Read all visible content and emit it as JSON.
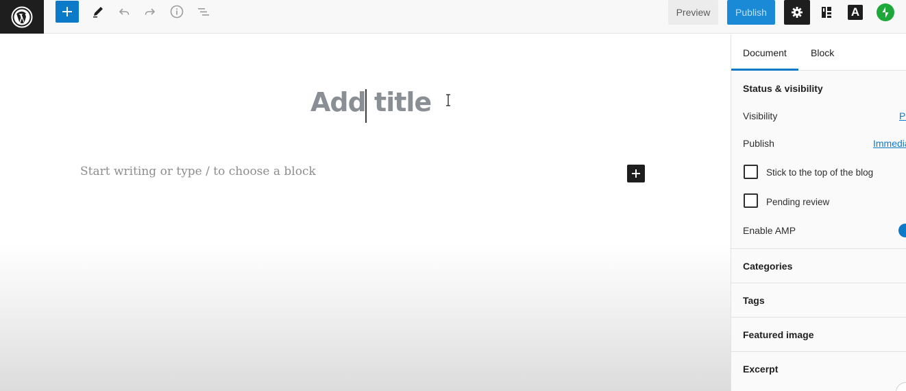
{
  "toolbar": {
    "preview_label": "Preview",
    "publish_label": "Publish",
    "icons": [
      "wordpress-logo",
      "plus-icon",
      "pencil-icon",
      "undo-icon",
      "redo-icon",
      "info-icon",
      "list-view-icon",
      "gear-icon",
      "block-layout-icon",
      "amp-icon",
      "jetpack-icon"
    ],
    "amp_letter": "A"
  },
  "editor": {
    "title_placeholder": "Add title",
    "body_placeholder": "Start writing or type / to choose a block"
  },
  "sidebar": {
    "tabs": [
      {
        "label": "Document",
        "active": true
      },
      {
        "label": "Block",
        "active": false
      }
    ],
    "status_visibility": {
      "title": "Status & visibility",
      "visibility_label": "Visibility",
      "visibility_value": "Pr",
      "publish_label": "Publish",
      "publish_value": "Immedia",
      "stick_label": "Stick to the top of the blog",
      "pending_label": "Pending review",
      "amp_label": "Enable AMP"
    },
    "sections": [
      "Categories",
      "Tags",
      "Featured image",
      "Excerpt"
    ]
  },
  "colors": {
    "accent": "#0a7ac9",
    "publish_bg": "#1a8ad6",
    "jetpack_green": "#1fa83a",
    "dark": "#1e1e1e"
  }
}
